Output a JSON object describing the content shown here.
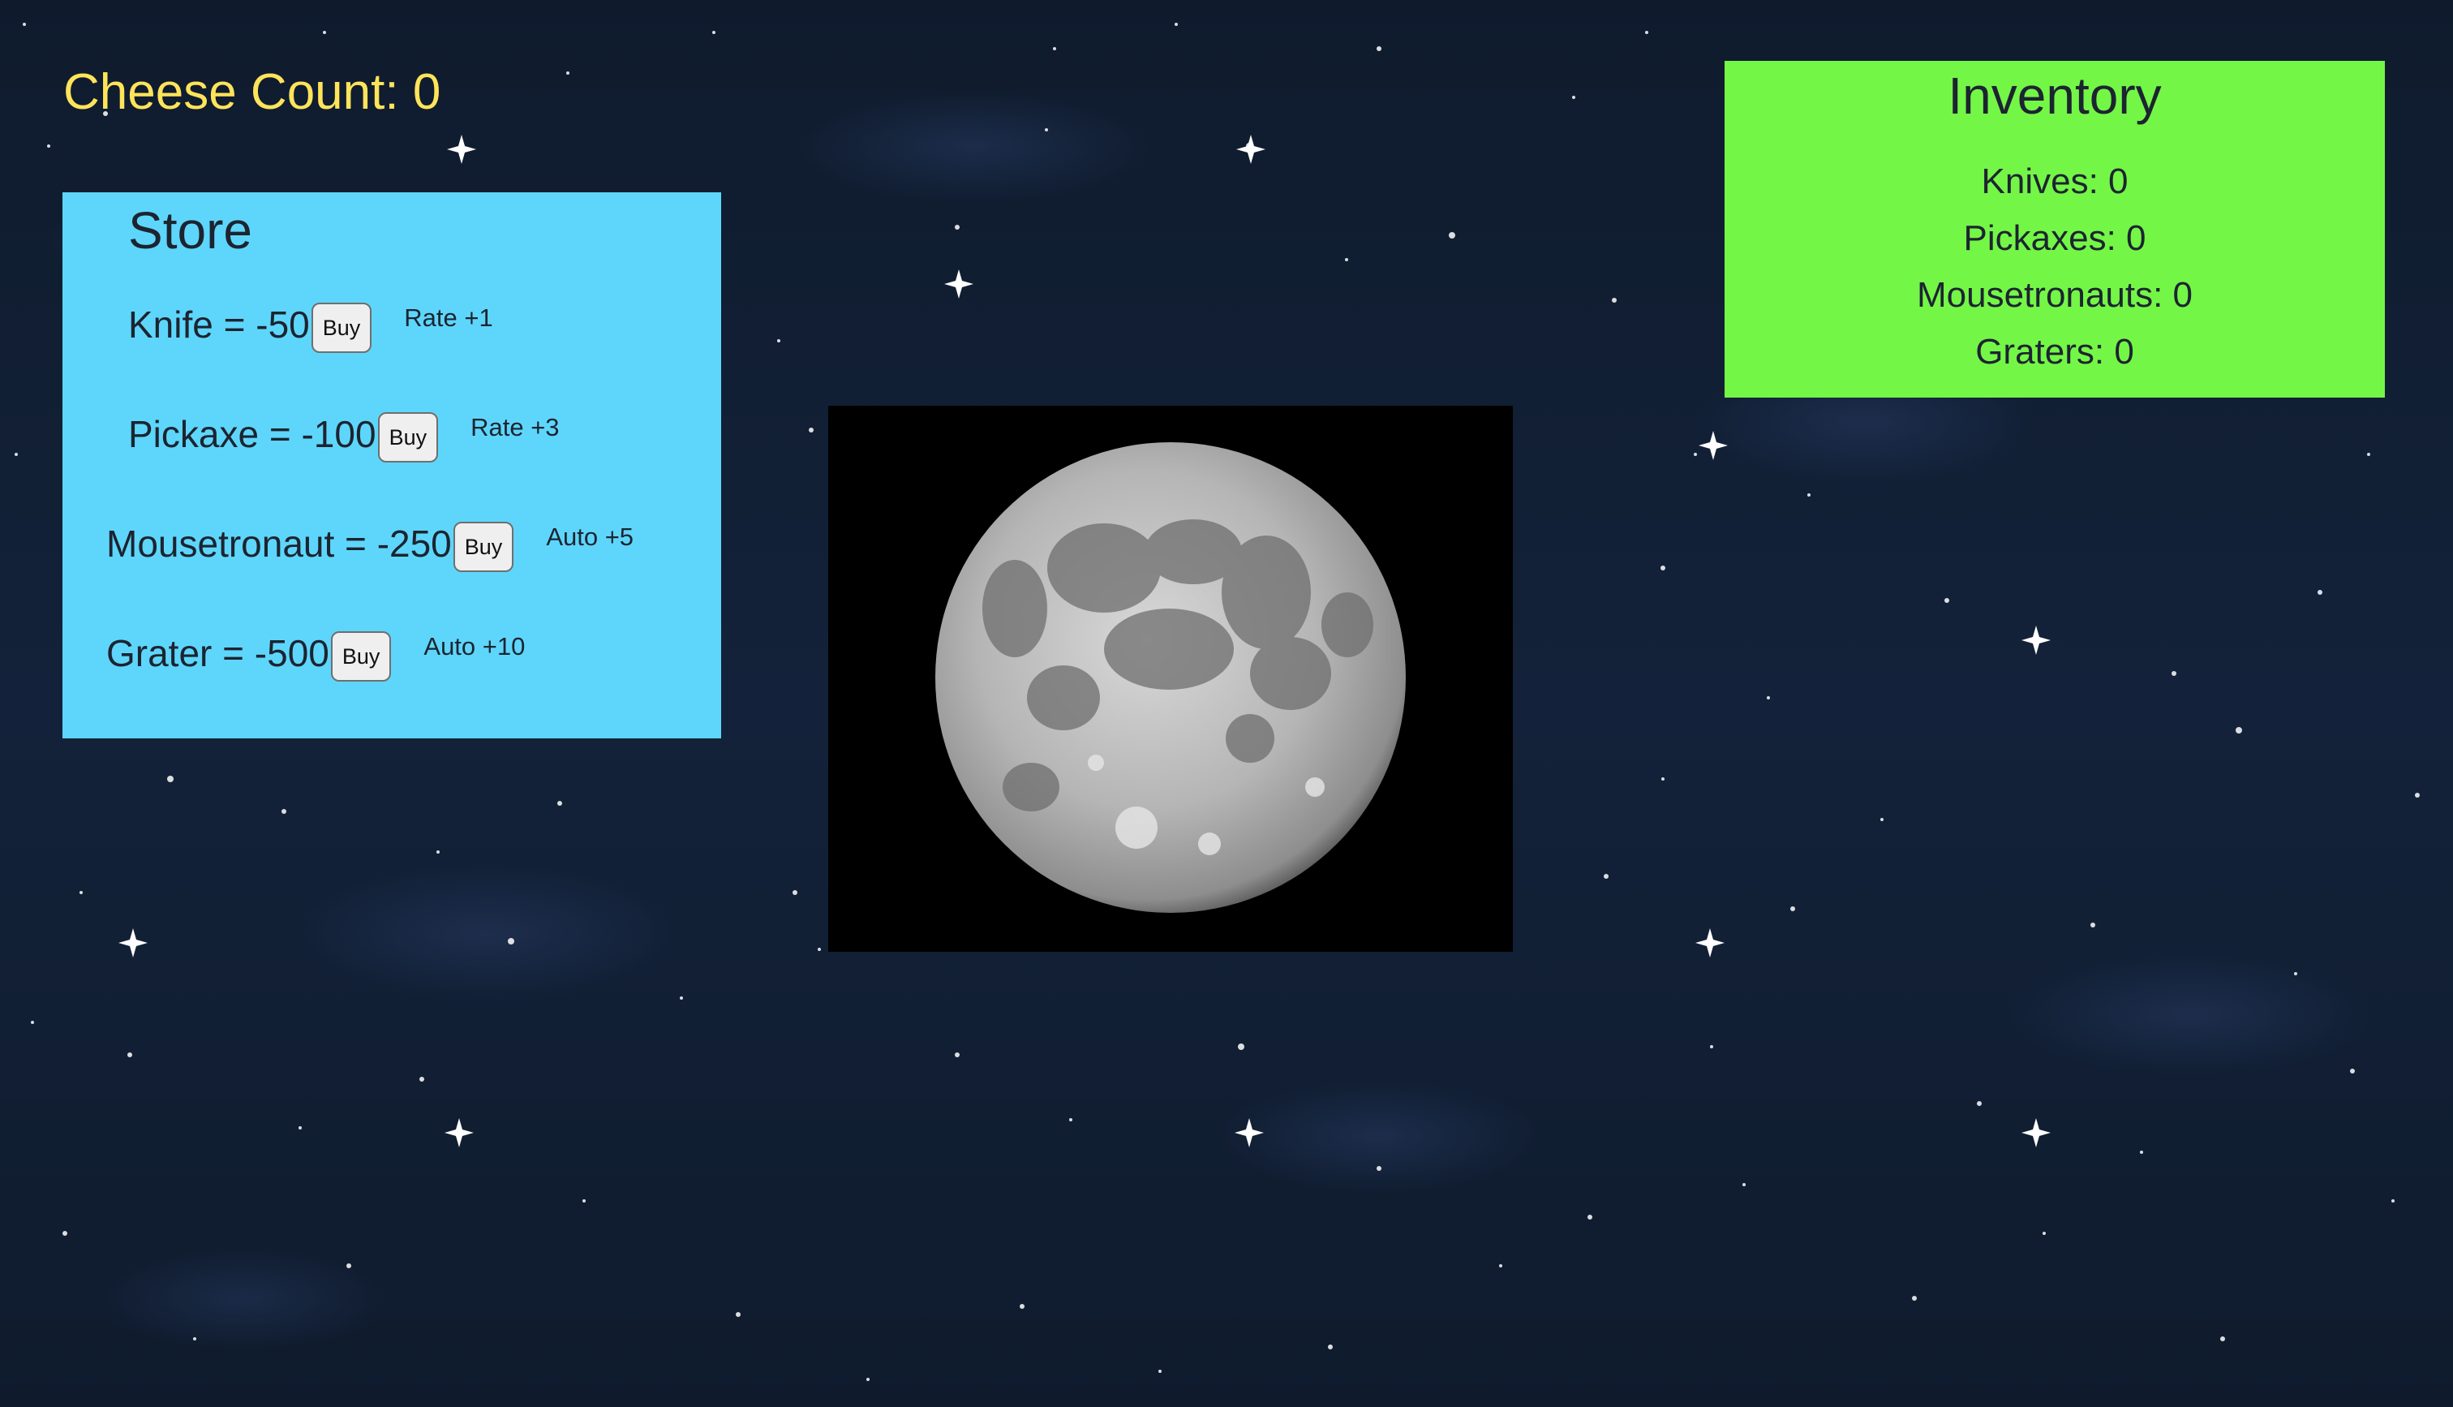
{
  "header": {
    "cheese_count": "Cheese Count: 0"
  },
  "store": {
    "title": "Store",
    "items": [
      {
        "label": "Knife = -50",
        "button": "Buy",
        "effect": "Rate +1"
      },
      {
        "label": "Pickaxe = -100",
        "button": "Buy",
        "effect": "Rate +3"
      },
      {
        "label": "Mousetronaut = -250",
        "button": "Buy",
        "effect": "Auto +5"
      },
      {
        "label": "Grater = -500",
        "button": "Buy",
        "effect": "Auto +10"
      }
    ]
  },
  "inventory": {
    "title": "Inventory",
    "items": [
      {
        "label": "Knives: 0"
      },
      {
        "label": "Pickaxes: 0"
      },
      {
        "label": "Mousetronauts: 0"
      },
      {
        "label": "Graters: 0"
      }
    ]
  },
  "colors": {
    "cheese_text": "#fde45a",
    "store_bg": "#5ed6fb",
    "inventory_bg": "#74f647",
    "background": "#0e1a2b"
  },
  "icons": {
    "moon": "moon-image"
  }
}
